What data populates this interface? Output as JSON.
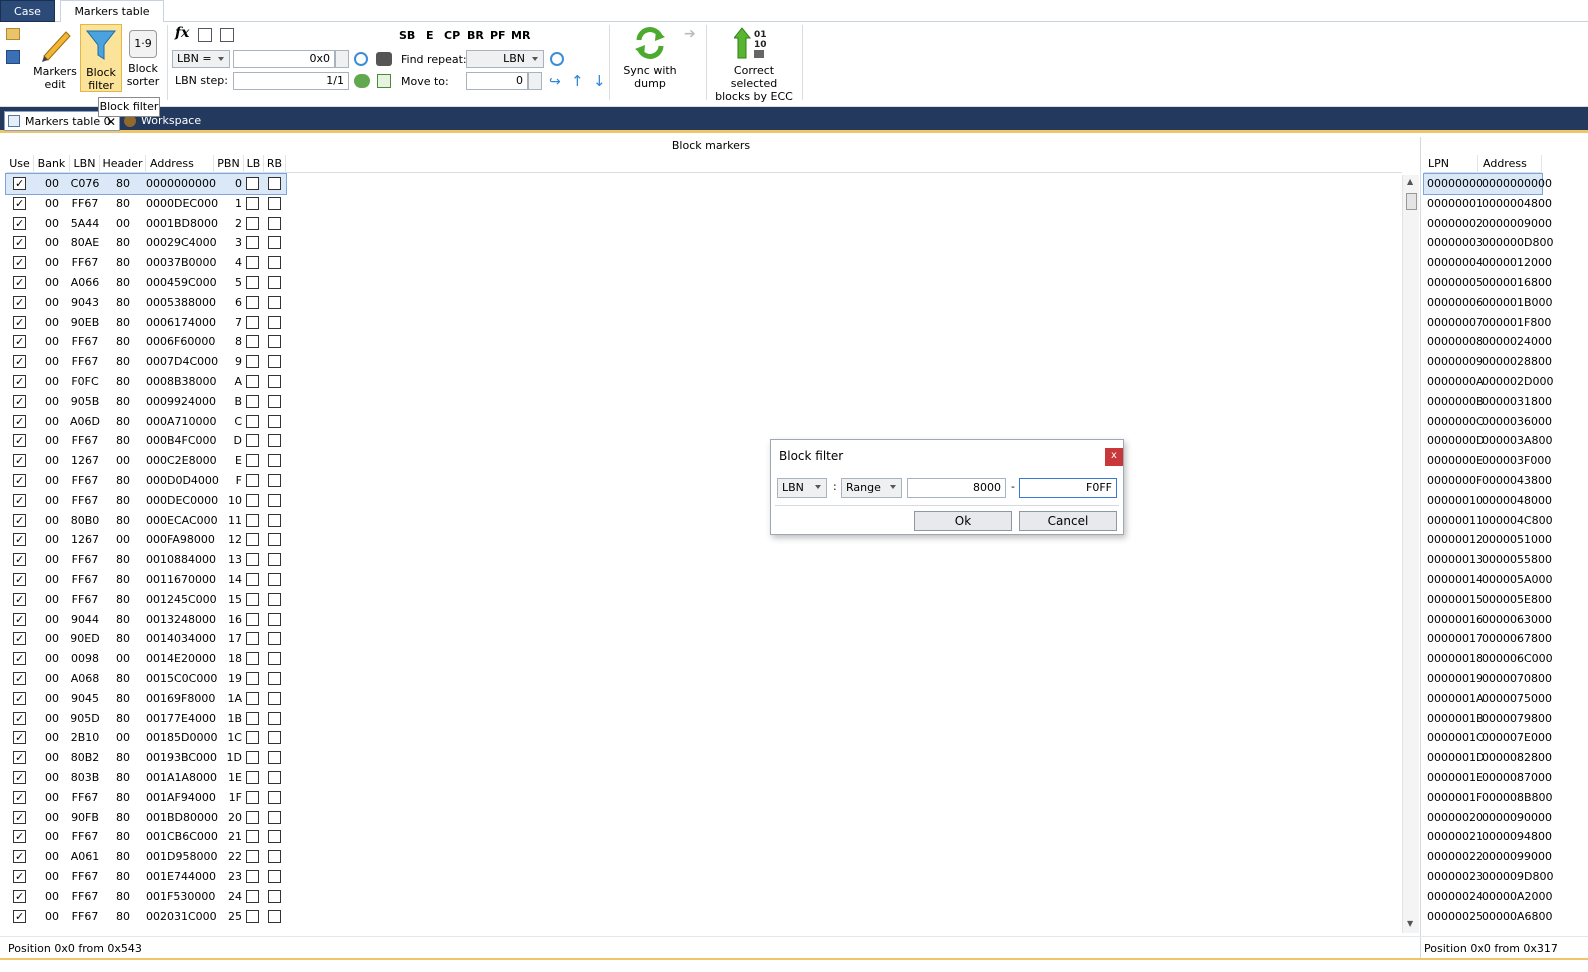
{
  "tabs": {
    "case": "Case",
    "markers_table": "Markers table"
  },
  "ribbon": {
    "markers_edit": [
      "Markers",
      "edit"
    ],
    "block_filter": [
      "Block",
      "filter"
    ],
    "block_sorter": [
      "Block",
      "sorter"
    ],
    "sorter_icon_text": "1·9",
    "fx_label": "fx",
    "lbn_combo": "LBN =",
    "lbn_value": "0x0",
    "lbn_step_label": "LBN step:",
    "lbn_step_value": "1/1",
    "flags": [
      "SB",
      "E",
      "CP",
      "BR",
      "PF",
      "MR"
    ],
    "find_repeat_label": "Find repeat:",
    "find_repeat_value": "LBN",
    "move_to_label": "Move to:",
    "move_to_value": "0",
    "sync": [
      "Sync with",
      "dump"
    ],
    "correct": [
      "Correct selected",
      "blocks by ECC"
    ],
    "ecc_bits": [
      "01",
      "10"
    ]
  },
  "tooltip": "Block filter",
  "doc_tabs": {
    "tab1": "Markers table 0",
    "tab2": "Workspace"
  },
  "panel_title": "Block markers",
  "left_columns": [
    "Use",
    "Bank",
    "LBN",
    "Header",
    "Address",
    "PBN",
    "LB",
    "RB"
  ],
  "rows": [
    [
      "00",
      "C076",
      "80",
      "0000000000",
      "0"
    ],
    [
      "00",
      "FF67",
      "80",
      "0000DEC000",
      "1"
    ],
    [
      "00",
      "5A44",
      "00",
      "0001BD8000",
      "2"
    ],
    [
      "00",
      "80AE",
      "80",
      "00029C4000",
      "3"
    ],
    [
      "00",
      "FF67",
      "80",
      "00037B0000",
      "4"
    ],
    [
      "00",
      "A066",
      "80",
      "000459C000",
      "5"
    ],
    [
      "00",
      "9043",
      "80",
      "0005388000",
      "6"
    ],
    [
      "00",
      "90EB",
      "80",
      "0006174000",
      "7"
    ],
    [
      "00",
      "FF67",
      "80",
      "0006F60000",
      "8"
    ],
    [
      "00",
      "FF67",
      "80",
      "0007D4C000",
      "9"
    ],
    [
      "00",
      "F0FC",
      "80",
      "0008B38000",
      "A"
    ],
    [
      "00",
      "905B",
      "80",
      "0009924000",
      "B"
    ],
    [
      "00",
      "A06D",
      "80",
      "000A710000",
      "C"
    ],
    [
      "00",
      "FF67",
      "80",
      "000B4FC000",
      "D"
    ],
    [
      "00",
      "1267",
      "00",
      "000C2E8000",
      "E"
    ],
    [
      "00",
      "FF67",
      "80",
      "000D0D4000",
      "F"
    ],
    [
      "00",
      "FF67",
      "80",
      "000DEC0000",
      "10"
    ],
    [
      "00",
      "80B0",
      "80",
      "000ECAC000",
      "11"
    ],
    [
      "00",
      "1267",
      "00",
      "000FA98000",
      "12"
    ],
    [
      "00",
      "FF67",
      "80",
      "0010884000",
      "13"
    ],
    [
      "00",
      "FF67",
      "80",
      "0011670000",
      "14"
    ],
    [
      "00",
      "FF67",
      "80",
      "001245C000",
      "15"
    ],
    [
      "00",
      "9044",
      "80",
      "0013248000",
      "16"
    ],
    [
      "00",
      "90ED",
      "80",
      "0014034000",
      "17"
    ],
    [
      "00",
      "0098",
      "00",
      "0014E20000",
      "18"
    ],
    [
      "00",
      "A068",
      "80",
      "0015C0C000",
      "19"
    ],
    [
      "00",
      "9045",
      "80",
      "00169F8000",
      "1A"
    ],
    [
      "00",
      "905D",
      "80",
      "00177E4000",
      "1B"
    ],
    [
      "00",
      "2B10",
      "00",
      "00185D0000",
      "1C"
    ],
    [
      "00",
      "80B2",
      "80",
      "00193BC000",
      "1D"
    ],
    [
      "00",
      "803B",
      "80",
      "001A1A8000",
      "1E"
    ],
    [
      "00",
      "FF67",
      "80",
      "001AF94000",
      "1F"
    ],
    [
      "00",
      "90FB",
      "80",
      "001BD80000",
      "20"
    ],
    [
      "00",
      "FF67",
      "80",
      "001CB6C000",
      "21"
    ],
    [
      "00",
      "A061",
      "80",
      "001D958000",
      "22"
    ],
    [
      "00",
      "FF67",
      "80",
      "001E744000",
      "23"
    ],
    [
      "00",
      "FF67",
      "80",
      "001F530000",
      "24"
    ],
    [
      "00",
      "FF67",
      "80",
      "002031C000",
      "25"
    ]
  ],
  "right_columns": [
    "LPN",
    "Address"
  ],
  "right_rows": [
    [
      "00000000",
      "0000000000"
    ],
    [
      "00000001",
      "0000004800"
    ],
    [
      "00000002",
      "0000009000"
    ],
    [
      "00000003",
      "000000D800"
    ],
    [
      "00000004",
      "0000012000"
    ],
    [
      "00000005",
      "0000016800"
    ],
    [
      "00000006",
      "000001B000"
    ],
    [
      "00000007",
      "000001F800"
    ],
    [
      "00000008",
      "0000024000"
    ],
    [
      "00000009",
      "0000028800"
    ],
    [
      "0000000A",
      "000002D000"
    ],
    [
      "0000000B",
      "0000031800"
    ],
    [
      "0000000C",
      "0000036000"
    ],
    [
      "0000000D",
      "000003A800"
    ],
    [
      "0000000E",
      "000003F000"
    ],
    [
      "0000000F",
      "0000043800"
    ],
    [
      "00000010",
      "0000048000"
    ],
    [
      "00000011",
      "000004C800"
    ],
    [
      "00000012",
      "0000051000"
    ],
    [
      "00000013",
      "0000055800"
    ],
    [
      "00000014",
      "000005A000"
    ],
    [
      "00000015",
      "000005E800"
    ],
    [
      "00000016",
      "0000063000"
    ],
    [
      "00000017",
      "0000067800"
    ],
    [
      "00000018",
      "000006C000"
    ],
    [
      "00000019",
      "0000070800"
    ],
    [
      "0000001A",
      "0000075000"
    ],
    [
      "0000001B",
      "0000079800"
    ],
    [
      "0000001C",
      "000007E000"
    ],
    [
      "0000001D",
      "0000082800"
    ],
    [
      "0000001E",
      "0000087000"
    ],
    [
      "0000001F",
      "000008B800"
    ],
    [
      "00000020",
      "0000090000"
    ],
    [
      "00000021",
      "0000094800"
    ],
    [
      "00000022",
      "0000099000"
    ],
    [
      "00000023",
      "000009D800"
    ],
    [
      "00000024",
      "00000A2000"
    ],
    [
      "00000025",
      "00000A6800"
    ]
  ],
  "status_left": "Position 0x0 from 0x543",
  "status_right": "Position 0x0 from 0x317",
  "dialog": {
    "title": "Block filter",
    "field": "LBN",
    "mode": "Range",
    "colon": ":",
    "from": "8000",
    "dash": "-",
    "to": "F0FF",
    "ok": "Ok",
    "cancel": "Cancel",
    "close": "x"
  },
  "colors": {
    "accent": "#233a5e",
    "tab_active": "#2c4a78",
    "highlight": "#f0c568",
    "close": "#c8383a"
  }
}
